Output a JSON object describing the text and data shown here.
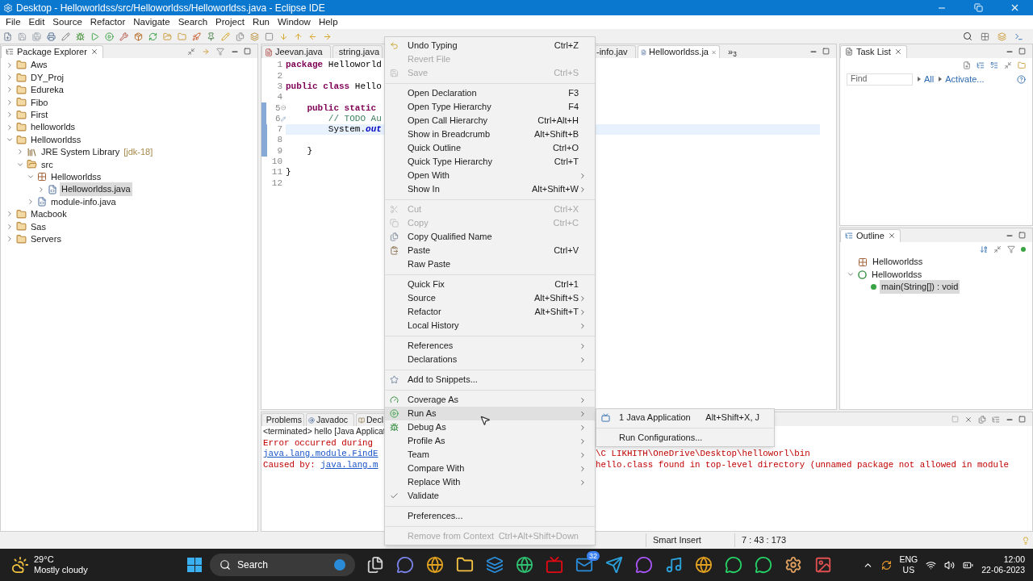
{
  "window": {
    "title": "Desktop - Helloworldss/src/Helloworldss/Helloworldss.java - Eclipse IDE"
  },
  "menu_bar": [
    "File",
    "Edit",
    "Source",
    "Refactor",
    "Navigate",
    "Search",
    "Project",
    "Run",
    "Window",
    "Help"
  ],
  "package_explorer": {
    "title": "Package Explorer",
    "items": [
      {
        "label": "Aws",
        "kind": "project",
        "expanded": false,
        "selected": false
      },
      {
        "label": "DY_Proj",
        "kind": "project",
        "expanded": false,
        "selected": false
      },
      {
        "label": "Edureka",
        "kind": "project",
        "expanded": false,
        "selected": false
      },
      {
        "label": "Fibo",
        "kind": "project",
        "expanded": false,
        "selected": false
      },
      {
        "label": "First",
        "kind": "project",
        "expanded": false,
        "selected": false
      },
      {
        "label": "helloworlds",
        "kind": "project",
        "expanded": false,
        "selected": false
      },
      {
        "label": "Helloworldss",
        "kind": "project",
        "expanded": true,
        "selected": false,
        "children": [
          {
            "label": "JRE System Library",
            "decoration": "[jdk-18]",
            "kind": "library",
            "expanded": false,
            "selected": false
          },
          {
            "label": "src",
            "kind": "source-folder",
            "expanded": true,
            "selected": false,
            "children": [
              {
                "label": "Helloworldss",
                "kind": "package",
                "expanded": true,
                "selected": false,
                "children": [
                  {
                    "label": "Helloworldss.java",
                    "kind": "java-file",
                    "expanded": false,
                    "selected": true
                  }
                ]
              },
              {
                "label": "module-info.java",
                "kind": "java-file",
                "expanded": false,
                "selected": false
              }
            ]
          }
        ]
      },
      {
        "label": "Macbook",
        "kind": "project",
        "expanded": false,
        "selected": false
      },
      {
        "label": "Sas",
        "kind": "project",
        "expanded": false,
        "selected": false
      },
      {
        "label": "Servers",
        "kind": "project",
        "expanded": false,
        "selected": false
      }
    ]
  },
  "editor": {
    "tabs": [
      {
        "label": "Jeevan.java",
        "selected": false
      },
      {
        "label": "string.java",
        "selected": false
      },
      {
        "label": "-info.jav",
        "selected": false
      },
      {
        "label": "Helloworldss.ja",
        "selected": true
      }
    ],
    "overflow": "»",
    "overflow_count": "3",
    "lines": [
      {
        "number": "1",
        "kind": "plain",
        "changed": false,
        "current": false,
        "tokens": [
          {
            "text": "package",
            "kind": "keyword"
          },
          {
            "text": " Helloworld",
            "kind": "plain"
          }
        ]
      },
      {
        "number": "2",
        "kind": "plain",
        "changed": false,
        "current": false
      },
      {
        "number": "3",
        "kind": "plain",
        "changed": false,
        "current": false,
        "tokens": [
          {
            "text": "public class",
            "kind": "keyword"
          },
          {
            "text": " Hello",
            "kind": "plain"
          }
        ]
      },
      {
        "number": "4",
        "kind": "plain",
        "changed": false,
        "current": false
      },
      {
        "number": "5",
        "kind": "fold",
        "changed": true,
        "current": false,
        "tokens": [
          {
            "text": "    public static",
            "kind": "keyword"
          }
        ]
      },
      {
        "number": "6",
        "kind": "task",
        "changed": true,
        "current": false,
        "tokens": [
          {
            "text": "        // TODO Au",
            "kind": "comment"
          }
        ]
      },
      {
        "number": "7",
        "kind": "plain",
        "changed": true,
        "current": true,
        "tokens": [
          {
            "text": "        System.",
            "kind": "plain"
          },
          {
            "text": "out",
            "kind": "field"
          }
        ]
      },
      {
        "number": "8",
        "kind": "plain",
        "changed": true,
        "current": false
      },
      {
        "number": "9",
        "kind": "plain",
        "changed": true,
        "current": false,
        "tokens": [
          {
            "text": "    }",
            "kind": "plain"
          }
        ]
      },
      {
        "number": "10",
        "kind": "plain",
        "changed": false,
        "current": false
      },
      {
        "number": "11",
        "kind": "plain",
        "changed": false,
        "current": false,
        "tokens": [
          {
            "text": "}",
            "kind": "plain"
          }
        ]
      },
      {
        "number": "12",
        "kind": "plain",
        "changed": false,
        "current": false
      }
    ]
  },
  "console": {
    "tabs": [
      {
        "label": "Problems",
        "selected": false
      },
      {
        "label": "Javadoc",
        "selected": false
      },
      {
        "label": "Decl",
        "selected": false
      }
    ],
    "header": "<terminated> hello [Java Applicat",
    "lines": [
      {
        "parts": [
          {
            "text": "Error occurred during",
            "kind": "plain"
          }
        ]
      },
      {
        "parts": [
          {
            "text": "java.lang.module.FindE",
            "kind": "link"
          }
        ],
        "continuation": "\\C LIKHITH\\OneDrive\\Desktop\\helloworl\\bin"
      },
      {
        "parts": [
          {
            "text": "Caused by: ",
            "kind": "plain"
          },
          {
            "text": "java.lang.m",
            "kind": "link"
          }
        ],
        "continuation": "hello.class found in top-level directory (unnamed package not allowed in module"
      }
    ]
  },
  "task_list": {
    "title": "Task List",
    "find_placeholder": "Find",
    "filters": [
      "All",
      "Activate..."
    ]
  },
  "outline": {
    "title": "Outline",
    "items": [
      {
        "label": "Helloworldss",
        "kind": "package",
        "selected": false
      },
      {
        "label": "Helloworldss",
        "kind": "class",
        "expanded": true,
        "selected": false,
        "children": [
          {
            "label": "main(String[]) : void",
            "kind": "method",
            "selected": true
          }
        ]
      }
    ]
  },
  "context_menu": {
    "items": [
      {
        "kind": "item",
        "label": "Undo Typing",
        "shortcut": "Ctrl+Z",
        "disabled": false,
        "submenu": false,
        "selected": false
      },
      {
        "kind": "item",
        "label": "Revert File",
        "disabled": true,
        "submenu": false,
        "selected": false
      },
      {
        "kind": "item",
        "label": "Save",
        "shortcut": "Ctrl+S",
        "disabled": true,
        "submenu": false,
        "selected": false
      },
      {
        "kind": "separator"
      },
      {
        "kind": "item",
        "label": "Open Declaration",
        "shortcut": "F3",
        "disabled": false,
        "submenu": false,
        "selected": false
      },
      {
        "kind": "item",
        "label": "Open Type Hierarchy",
        "shortcut": "F4",
        "disabled": false,
        "submenu": false,
        "selected": false
      },
      {
        "kind": "item",
        "label": "Open Call Hierarchy",
        "shortcut": "Ctrl+Alt+H",
        "disabled": false,
        "submenu": false,
        "selected": false
      },
      {
        "kind": "item",
        "label": "Show in Breadcrumb",
        "shortcut": "Alt+Shift+B",
        "disabled": false,
        "submenu": false,
        "selected": false
      },
      {
        "kind": "item",
        "label": "Quick Outline",
        "shortcut": "Ctrl+O",
        "disabled": false,
        "submenu": false,
        "selected": false
      },
      {
        "kind": "item",
        "label": "Quick Type Hierarchy",
        "shortcut": "Ctrl+T",
        "disabled": false,
        "submenu": false,
        "selected": false
      },
      {
        "kind": "item",
        "label": "Open With",
        "disabled": false,
        "submenu": true,
        "selected": false
      },
      {
        "kind": "item",
        "label": "Show In",
        "shortcut": "Alt+Shift+W",
        "disabled": false,
        "submenu": true,
        "selected": false
      },
      {
        "kind": "separator"
      },
      {
        "kind": "item",
        "label": "Cut",
        "shortcut": "Ctrl+X",
        "disabled": true,
        "submenu": false,
        "selected": false
      },
      {
        "kind": "item",
        "label": "Copy",
        "shortcut": "Ctrl+C",
        "disabled": true,
        "submenu": false,
        "selected": false
      },
      {
        "kind": "item",
        "label": "Copy Qualified Name",
        "disabled": false,
        "submenu": false,
        "selected": false
      },
      {
        "kind": "item",
        "label": "Paste",
        "shortcut": "Ctrl+V",
        "disabled": false,
        "submenu": false,
        "selected": false
      },
      {
        "kind": "item",
        "label": "Raw Paste",
        "disabled": false,
        "submenu": false,
        "selected": false
      },
      {
        "kind": "separator"
      },
      {
        "kind": "item",
        "label": "Quick Fix",
        "shortcut": "Ctrl+1",
        "disabled": false,
        "submenu": false,
        "selected": false
      },
      {
        "kind": "item",
        "label": "Source",
        "shortcut": "Alt+Shift+S",
        "disabled": false,
        "submenu": true,
        "selected": false
      },
      {
        "kind": "item",
        "label": "Refactor",
        "shortcut": "Alt+Shift+T",
        "disabled": false,
        "submenu": true,
        "selected": false
      },
      {
        "kind": "item",
        "label": "Local History",
        "disabled": false,
        "submenu": true,
        "selected": false
      },
      {
        "kind": "separator"
      },
      {
        "kind": "item",
        "label": "References",
        "disabled": false,
        "submenu": true,
        "selected": false
      },
      {
        "kind": "item",
        "label": "Declarations",
        "disabled": false,
        "submenu": true,
        "selected": false
      },
      {
        "kind": "separator"
      },
      {
        "kind": "item",
        "label": "Add to Snippets...",
        "disabled": false,
        "submenu": false,
        "selected": false
      },
      {
        "kind": "separator"
      },
      {
        "kind": "item",
        "label": "Coverage As",
        "disabled": false,
        "submenu": true,
        "selected": false
      },
      {
        "kind": "item",
        "label": "Run As",
        "disabled": false,
        "submenu": true,
        "selected": true
      },
      {
        "kind": "item",
        "label": "Debug As",
        "disabled": false,
        "submenu": true,
        "selected": false
      },
      {
        "kind": "item",
        "label": "Profile As",
        "disabled": false,
        "submenu": true,
        "selected": false
      },
      {
        "kind": "item",
        "label": "Team",
        "disabled": false,
        "submenu": true,
        "selected": false
      },
      {
        "kind": "item",
        "label": "Compare With",
        "disabled": false,
        "submenu": true,
        "selected": false
      },
      {
        "kind": "item",
        "label": "Replace With",
        "disabled": false,
        "submenu": true,
        "selected": false
      },
      {
        "kind": "item",
        "label": "Validate",
        "disabled": false,
        "submenu": false,
        "selected": false,
        "checked": true
      },
      {
        "kind": "separator"
      },
      {
        "kind": "item",
        "label": "Preferences...",
        "disabled": false,
        "submenu": false,
        "selected": false
      },
      {
        "kind": "separator"
      },
      {
        "kind": "item",
        "label": "Remove from Context",
        "shortcut": "Ctrl+Alt+Shift+Down",
        "disabled": true,
        "submenu": false,
        "selected": false
      }
    ]
  },
  "submenu": {
    "items": [
      {
        "kind": "item",
        "label": "1 Java Application",
        "shortcut": "Alt+Shift+X, J"
      },
      {
        "kind": "separator"
      },
      {
        "kind": "item",
        "label": "Run Configurations..."
      }
    ]
  },
  "status_bar": {
    "fields": [
      "Smart Insert",
      "7 : 43 : 173"
    ]
  },
  "taskbar": {
    "temperature": "29°C",
    "condition": "Mostly cloudy",
    "search_label": "Search",
    "mail_badge": "32",
    "language": "ENG",
    "region": "US",
    "time": "12:00",
    "date": "22-06-2023"
  }
}
